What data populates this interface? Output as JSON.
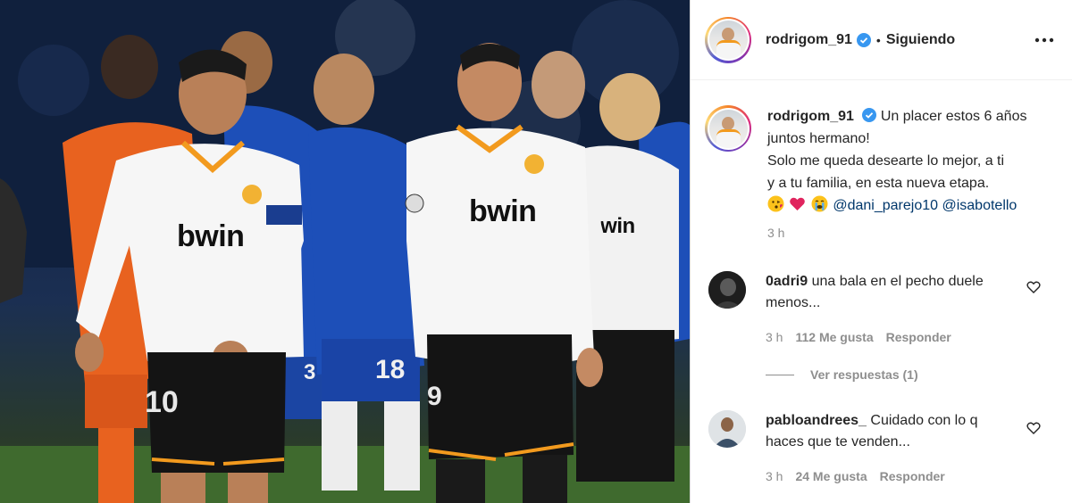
{
  "photo": {
    "description_icon": "football-players-photo",
    "sponsor_left": "bwin",
    "sponsor_right": "bwin",
    "sponsor_partial": "bwin",
    "number_left": "10",
    "number_right": "9",
    "number_blue": "18",
    "number_blue2": "3"
  },
  "header": {
    "username": "rodrigom_91",
    "separator": "•",
    "following": "Siguiendo"
  },
  "caption": {
    "username": "rodrigom_91",
    "line1": "Un placer estos 6 años",
    "line2": "juntos hermano!",
    "line3": "Solo me queda desearte lo mejor, a ti",
    "line4": "y a tu familia, en esta nueva etapa.",
    "emojis": [
      "kissing-face",
      "red-heart",
      "crying-face"
    ],
    "mention1": "@dani_parejo10",
    "mention2": "@isabotello",
    "time": "3 h"
  },
  "comments": [
    {
      "username": "0adri9",
      "text_line1": "una bala en el pecho duele",
      "text_line2": "menos...",
      "time": "3 h",
      "likes": "112 Me gusta",
      "reply": "Responder",
      "view_replies": "Ver respuestas (1)"
    },
    {
      "username": "pabloandrees_",
      "text_line1": "Cuidado con lo q",
      "text_line2": "haces que te venden...",
      "time": "3 h",
      "likes": "24 Me gusta",
      "reply": "Responder"
    }
  ],
  "colors": {
    "text": "#262626",
    "secondary": "#8e8e8e",
    "link": "#00376b",
    "verified": "#3897f0",
    "valencia_orange": "#f29a1e",
    "chelsea_blue": "#1d4fb8"
  }
}
